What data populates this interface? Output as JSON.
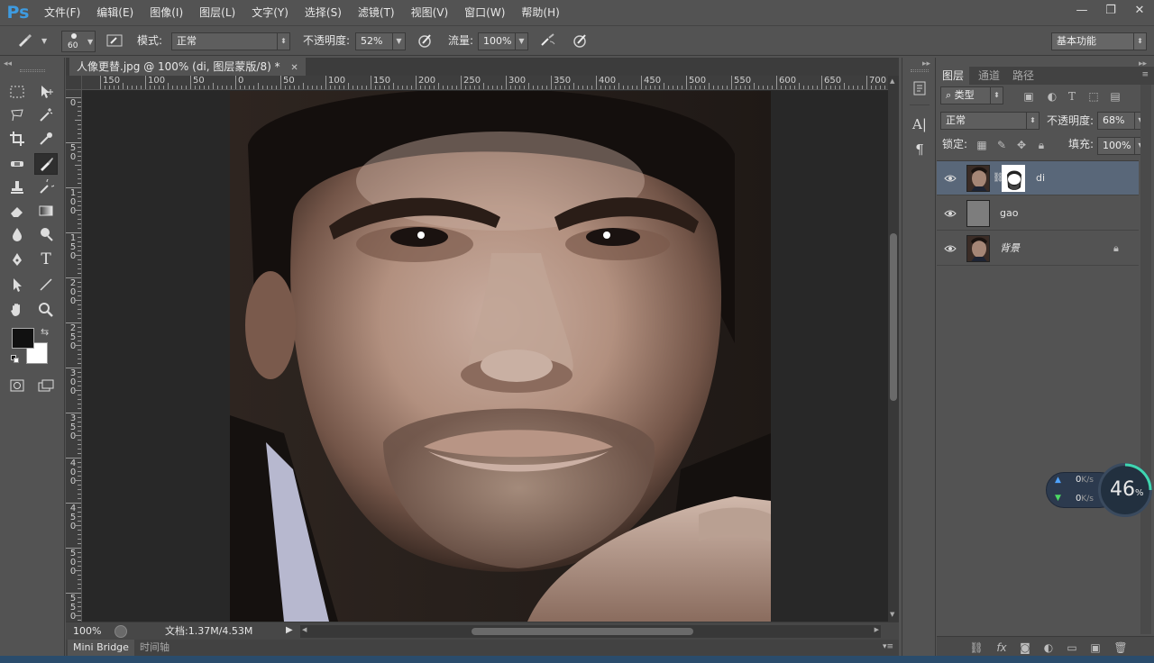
{
  "app": {
    "logo": "Ps"
  },
  "menu": [
    "文件(F)",
    "编辑(E)",
    "图像(I)",
    "图层(L)",
    "文字(Y)",
    "选择(S)",
    "滤镜(T)",
    "视图(V)",
    "窗口(W)",
    "帮助(H)"
  ],
  "window_controls": {
    "minimize": "—",
    "restore": "❐",
    "close": "✕"
  },
  "options": {
    "brush_size": "60",
    "mode_label": "模式:",
    "mode_value": "正常",
    "opacity_label": "不透明度:",
    "opacity_value": "52%",
    "flow_label": "流量:",
    "flow_value": "100%",
    "workspace": "基本功能"
  },
  "document": {
    "tab_title": "人像更替.jpg @ 100% (di, 图层蒙版/8) *",
    "zoom": "100%",
    "doc_size": "文档:1.37M/4.53M",
    "ruler_h": [
      "150",
      "100",
      "50",
      "0",
      "50",
      "100",
      "150",
      "200",
      "250",
      "300",
      "350",
      "400",
      "450",
      "500",
      "550",
      "600",
      "650",
      "700"
    ],
    "ruler_v": [
      "0",
      "5\n0",
      "1\n0\n0",
      "1\n5\n0",
      "2\n0\n0",
      "2\n5\n0",
      "3\n0\n0",
      "3\n5\n0",
      "4\n0\n0",
      "4\n5\n0",
      "5\n0\n0",
      "5\n5\n0"
    ]
  },
  "bottom_tabs": [
    "Mini Bridge",
    "时间轴"
  ],
  "layers_panel": {
    "tabs": [
      "图层",
      "通道",
      "路径"
    ],
    "filter_kind": "类型",
    "blend_mode": "正常",
    "opacity_label": "不透明度:",
    "opacity_value": "68%",
    "lock_label": "锁定:",
    "fill_label": "填充:",
    "fill_value": "100%",
    "layers": [
      {
        "name": "di",
        "selected": true,
        "has_mask": true
      },
      {
        "name": "gao",
        "selected": false,
        "has_mask": false
      },
      {
        "name": "背景",
        "selected": false,
        "has_mask": false,
        "locked": true
      }
    ]
  },
  "net_widget": {
    "upload": "0",
    "download": "0",
    "unit": "K/s",
    "percent": "46",
    "percent_sign": "%"
  }
}
